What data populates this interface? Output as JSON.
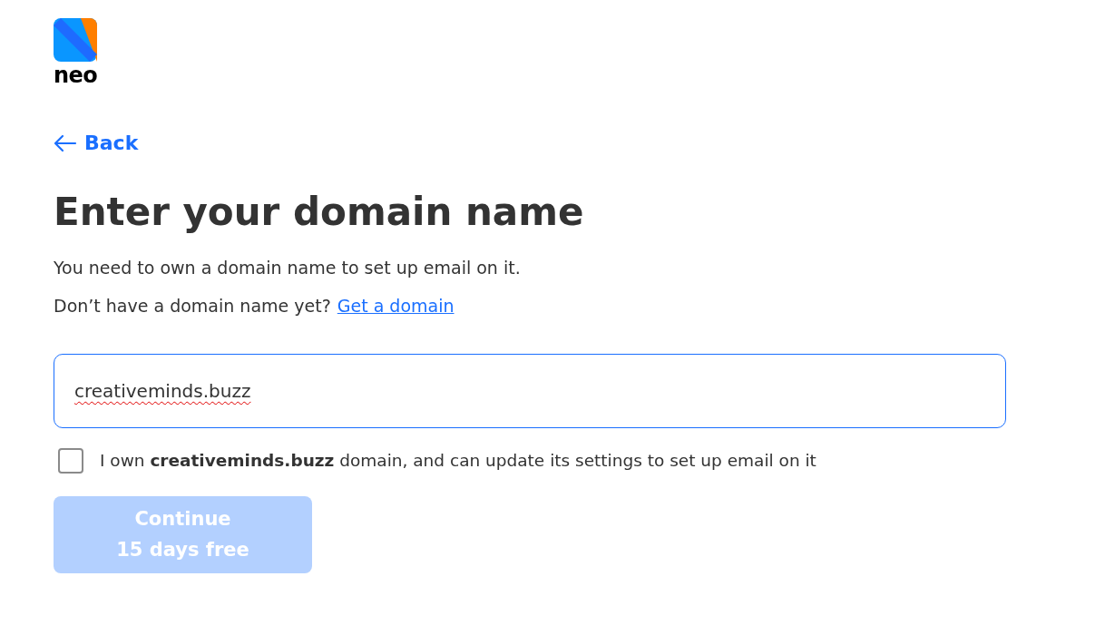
{
  "logo": {
    "text": "neo"
  },
  "back_link": {
    "label": "Back"
  },
  "title": "Enter your domain name",
  "description": "You need to own a domain name to set up email on it.",
  "prompt": {
    "text": "Don’t have a domain name yet?",
    "link": "Get a domain"
  },
  "domain_field": {
    "value": "creativeminds.buzz",
    "spellcheck_error": true,
    "focused": true
  },
  "ownership_checkbox": {
    "label": "I own **creativeminds.buzz** domain, and can update its settings to set up email on it",
    "checked": false
  },
  "continue_button": {
    "lines": [
      "Continue",
      "15 days free"
    ],
    "disabled": true
  }
}
